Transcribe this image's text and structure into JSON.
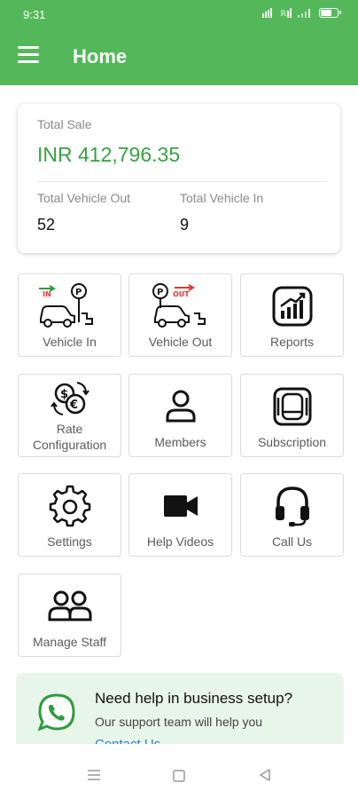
{
  "status_bar": {
    "time": "9:31",
    "battery": "68"
  },
  "header": {
    "title": "Home",
    "menu_icon": "hamburger-menu-icon",
    "background_color": "#54b85a"
  },
  "summary": {
    "total_sale_label": "Total Sale",
    "total_sale_value": "INR 412,796.35",
    "vehicle_out_label": "Total Vehicle Out",
    "vehicle_out_value": "52",
    "vehicle_in_label": "Total Vehicle In",
    "vehicle_in_value": "9",
    "accent_color": "#35a143"
  },
  "tiles": [
    {
      "label": "Vehicle In",
      "icon": "vehicle-in-icon",
      "badge": "IN"
    },
    {
      "label": "Vehicle Out",
      "icon": "vehicle-out-icon",
      "badge": "OUT"
    },
    {
      "label": "Reports",
      "icon": "reports-chart-icon"
    },
    {
      "label_line1": "Rate",
      "label_line2": "Configuration",
      "icon": "currency-exchange-icon"
    },
    {
      "label": "Members",
      "icon": "person-icon"
    },
    {
      "label": "Subscription",
      "icon": "subscription-card-icon"
    },
    {
      "label": "Settings",
      "icon": "gear-icon"
    },
    {
      "label": "Help Videos",
      "icon": "video-camera-icon"
    },
    {
      "label": "Call Us",
      "icon": "headset-icon"
    },
    {
      "label": "Manage Staff",
      "icon": "people-group-icon"
    }
  ],
  "help_banner": {
    "title": "Need help in business setup?",
    "subtitle": "Our support team will help you",
    "cta": "Contact Us →",
    "icon": "whatsapp-icon"
  },
  "nav_bar": {
    "recents_icon": "recents-icon",
    "home_icon": "home-square-icon",
    "back_icon": "back-triangle-icon"
  }
}
